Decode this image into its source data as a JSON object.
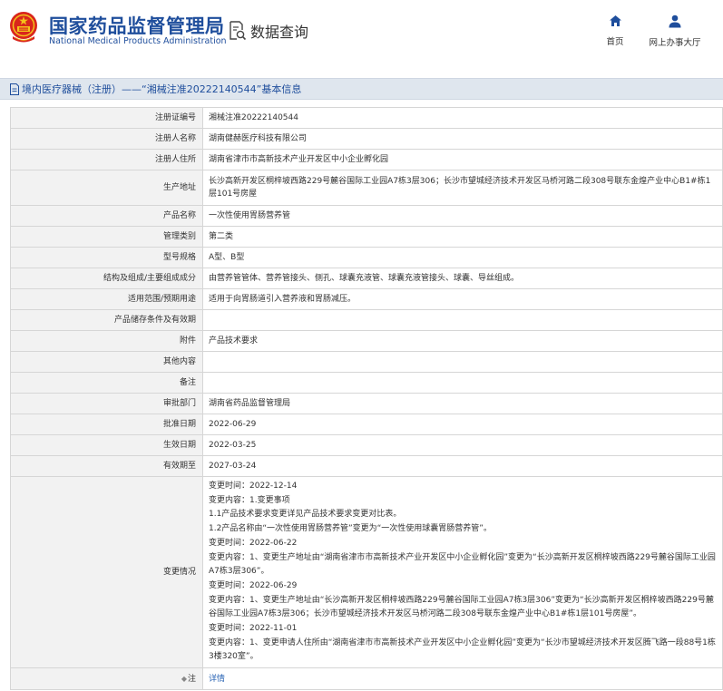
{
  "header": {
    "title_cn": "国家药品监督管理局",
    "title_en": "National Medical Products Administration",
    "query_label": "数据查询",
    "nav": {
      "home": "首页",
      "service_hall": "网上办事大厅"
    }
  },
  "breadcrumb": "境内医疗器械（注册）——“湘械注准20222140544”基本信息",
  "rows": [
    {
      "key": "注册证编号",
      "value": "湘械注准20222140544"
    },
    {
      "key": "注册人名称",
      "value": "湖南健赫医疗科技有限公司"
    },
    {
      "key": "注册人住所",
      "value": "湖南省津市市高新技术产业开发区中小企业孵化园"
    },
    {
      "key": "生产地址",
      "value": "长沙高新开发区桐梓坡西路229号麓谷国际工业园A7栋3层306；长沙市望城经济技术开发区马桥河路二段308号联东金煌产业中心B1#栋1层101号房屋"
    },
    {
      "key": "产品名称",
      "value": "一次性使用胃肠营养管"
    },
    {
      "key": "管理类别",
      "value": "第二类"
    },
    {
      "key": "型号规格",
      "value": "A型、B型"
    },
    {
      "key": "结构及组成/主要组成成分",
      "value": "由营养管管体、营养管接头、侧孔、球囊充液管、球囊充液管接头、球囊、导丝组成。"
    },
    {
      "key": "适用范围/预期用途",
      "value": "适用于向胃肠道引入营养液和胃肠减压。"
    },
    {
      "key": "产品储存条件及有效期",
      "value": ""
    },
    {
      "key": "附件",
      "value": "产品技术要求"
    },
    {
      "key": "其他内容",
      "value": ""
    },
    {
      "key": "备注",
      "value": ""
    },
    {
      "key": "审批部门",
      "value": "湖南省药品监督管理局"
    },
    {
      "key": "批准日期",
      "value": "2022-06-29"
    },
    {
      "key": "生效日期",
      "value": "2022-03-25"
    },
    {
      "key": "有效期至",
      "value": "2027-03-24"
    },
    {
      "key": "变更情况",
      "value": "变更时间：2022-12-14\n变更内容：1.变更事项\n1.1产品技术要求变更详见产品技术要求变更对比表。\n1.2产品名称由“一次性使用胃肠营养管”变更为“一次性使用球囊胃肠营养管”。\n变更时间：2022-06-22\n变更内容：1、变更生产地址由“湖南省津市市高新技术产业开发区中小企业孵化园”变更为“长沙高新开发区桐梓坡西路229号麓谷国际工业园A7栋3层306”。\n变更时间：2022-06-29\n变更内容：1、变更生产地址由“长沙高新开发区桐梓坡西路229号麓谷国际工业园A7栋3层306”变更为“长沙高新开发区桐梓坡西路229号麓谷国际工业园A7栋3层306；长沙市望城经济技术开发区马桥河路二段308号联东金煌产业中心B1#栋1层101号房屋”。\n变更时间：2022-11-01\n变更内容：1、变更申请人住所由“湖南省津市市高新技术产业开发区中小企业孵化园”变更为“长沙市望城经济技术开发区腾飞路一段88号1栋3楼320室”。"
    },
    {
      "key": "注",
      "value": "详情"
    }
  ]
}
